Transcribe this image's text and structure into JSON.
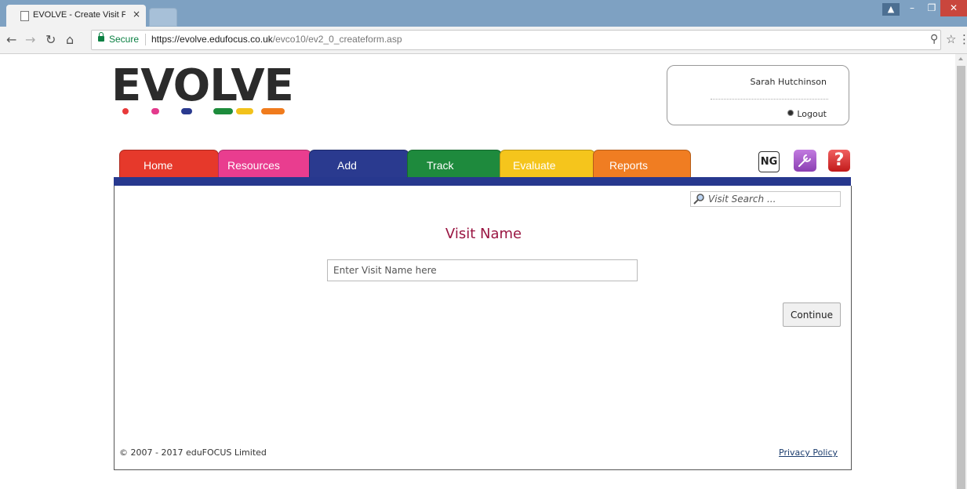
{
  "browser": {
    "tab_title": "EVOLVE - Create Visit For",
    "tab_close": "×",
    "secure_label": "Secure",
    "url_host": "https://evolve.edufocus.co.uk",
    "url_path": "/evco10/ev2_0_createform.asp"
  },
  "header": {
    "logo_text": "EVOLVE",
    "logo_dot_colors": [
      "#e8393a",
      "#e33a8c",
      "#2a3a8f",
      "#1d8c3c",
      "#f2c21b",
      "#f07b1d"
    ],
    "user_name": "Sarah Hutchinson",
    "logout_label": "Logout"
  },
  "nav": {
    "tabs": [
      {
        "label": "Home",
        "color": "#e6392b"
      },
      {
        "label": "Resources",
        "color": "#e93d8f"
      },
      {
        "label": "Add",
        "color": "#2a3a8f",
        "active": true
      },
      {
        "label": "Track",
        "color": "#1e8a3d"
      },
      {
        "label": "Evaluate",
        "color": "#f5c51c"
      },
      {
        "label": "Reports",
        "color": "#f07d22"
      }
    ],
    "tools": {
      "ng_label": "NG",
      "help_label": "?"
    }
  },
  "search": {
    "placeholder": "Visit Search ..."
  },
  "form": {
    "title": "Visit Name",
    "name_placeholder": "Enter Visit Name here",
    "continue_label": "Continue"
  },
  "footer": {
    "copyright": "© 2007 - 2017 eduFOCUS Limited",
    "privacy_label": "Privacy Policy"
  }
}
